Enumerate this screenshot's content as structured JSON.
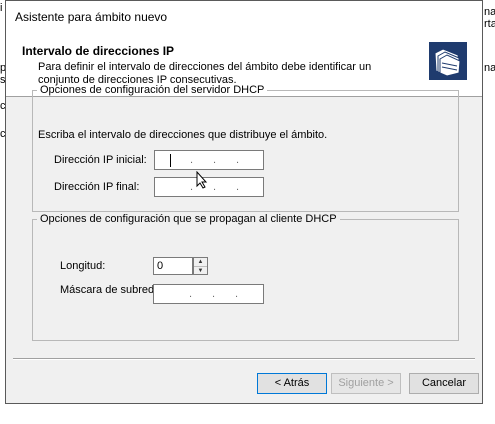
{
  "background": {
    "right_top": "nar",
    "right_second": "rta",
    "right_third": "na",
    "left_frags": [
      "i",
      "p",
      "s",
      "c",
      "c"
    ]
  },
  "dialog": {
    "title": "Asistente para ámbito nuevo",
    "header": {
      "title": "Intervalo de direcciones IP",
      "subtitle": "Para definir el intervalo de direcciones del ámbito debe identificar un conjunto de direcciones IP consecutivas.",
      "icon": "folders-wizard-icon"
    },
    "server_group": {
      "legend": "Opciones de configuración del servidor DHCP",
      "instruction": "Escriba el intervalo de direcciones que distribuye el ámbito.",
      "start_ip_label": "Dirección IP inicial:",
      "start_ip_value": "",
      "end_ip_label": "Dirección IP final:",
      "end_ip_value": ""
    },
    "client_group": {
      "legend": "Opciones de configuración que se propagan al cliente DHCP",
      "length_label": "Longitud:",
      "length_value": "0",
      "mask_label": "Máscara de subred:",
      "mask_value": ""
    },
    "buttons": {
      "back": "< Atrás",
      "next": "Siguiente >",
      "cancel": "Cancelar"
    }
  }
}
